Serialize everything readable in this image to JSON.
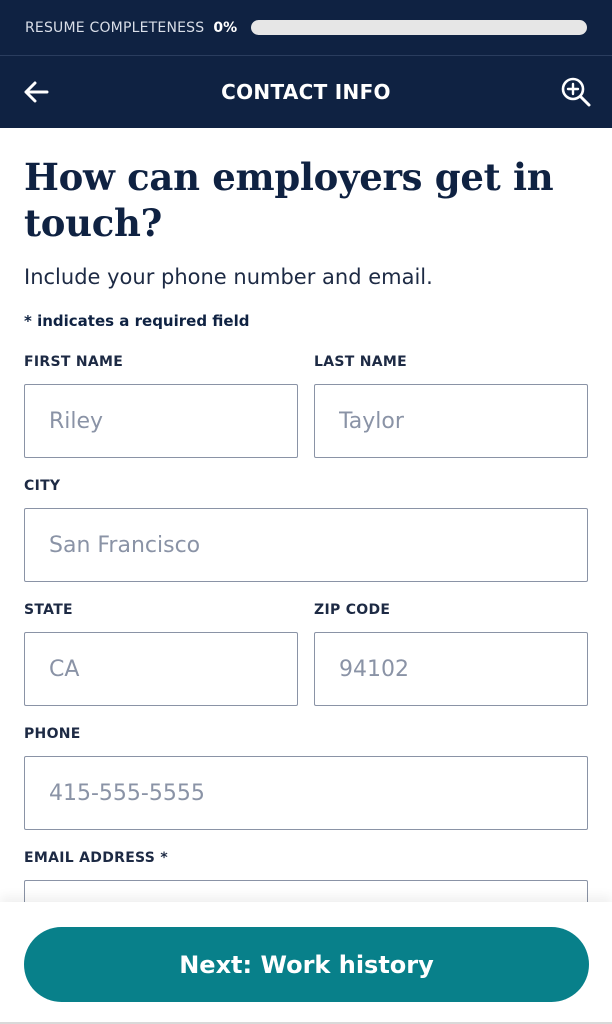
{
  "progress": {
    "label": "RESUME COMPLETENESS",
    "percent_text": "0%",
    "value": 0
  },
  "header": {
    "title": "CONTACT INFO",
    "back_icon": "arrow-left-icon",
    "zoom_icon": "zoom-in-icon"
  },
  "main": {
    "title": "How can employers get in touch?",
    "subtitle": "Include your phone number and email.",
    "required_note": "* indicates a required field"
  },
  "form": {
    "first_name": {
      "label": "FIRST NAME",
      "placeholder": "Riley"
    },
    "last_name": {
      "label": "LAST NAME",
      "placeholder": "Taylor"
    },
    "city": {
      "label": "CITY",
      "placeholder": "San Francisco"
    },
    "state": {
      "label": "STATE",
      "placeholder": "CA"
    },
    "zip": {
      "label": "ZIP CODE",
      "placeholder": "94102"
    },
    "phone": {
      "label": "PHONE",
      "placeholder": "415-555-5555"
    },
    "email": {
      "label": "EMAIL ADDRESS *",
      "placeholder": ""
    }
  },
  "footer": {
    "next_label": "Next: Work history"
  },
  "colors": {
    "navy": "#0f2242",
    "teal": "#08808a",
    "border": "#8a93a6"
  }
}
